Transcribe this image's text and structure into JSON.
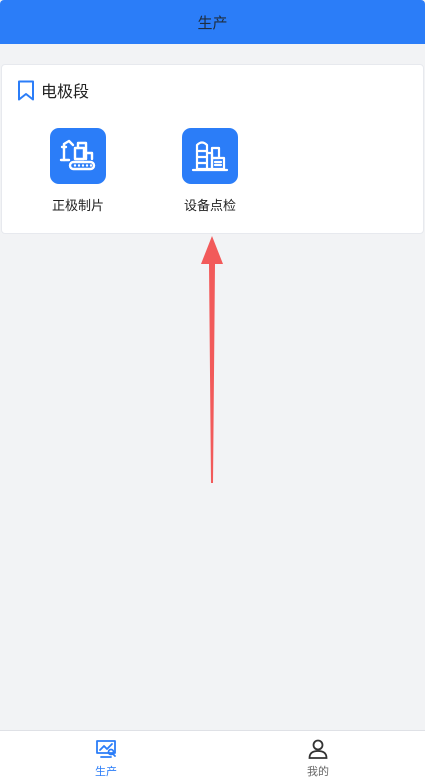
{
  "navbar": {
    "title": "生产"
  },
  "section": {
    "title": "电极段",
    "items": [
      {
        "label": "正极制片",
        "icon": "excavator-machine-icon"
      },
      {
        "label": "设备点检",
        "icon": "factory-equipment-icon"
      }
    ]
  },
  "tabbar": {
    "tabs": [
      {
        "label": "生产",
        "icon": "production-chart-icon",
        "active": true
      },
      {
        "label": "我的",
        "icon": "user-icon",
        "active": false
      }
    ]
  },
  "colors": {
    "primary": "#2b7df8",
    "arrow": "#f25a5a",
    "background": "#f2f3f5"
  }
}
